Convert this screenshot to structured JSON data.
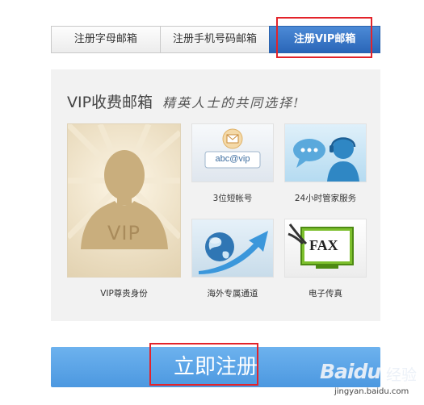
{
  "tabs": [
    {
      "label": "注册字母邮箱"
    },
    {
      "label": "注册手机号码邮箱"
    },
    {
      "label": "注册VIP邮箱",
      "active": true
    }
  ],
  "panel": {
    "heading": "VIP收费邮箱",
    "slogan": "精英人士的共同选择!",
    "vip_tile": {
      "text": "VIP",
      "caption": "VIP尊贵身份"
    },
    "features": [
      {
        "icon": "mail-address-icon",
        "text": "abc@vip",
        "caption": "3位短帐号"
      },
      {
        "icon": "chat-support-icon",
        "caption": "24小时管家服务"
      },
      {
        "icon": "globe-arrow-icon",
        "caption": "海外专属通道"
      },
      {
        "icon": "fax-monitor-icon",
        "text": "FAX",
        "caption": "电子传真"
      }
    ]
  },
  "register_button": {
    "label": "立即注册"
  },
  "watermark": {
    "logo": "Baidu",
    "suffix": "经验",
    "url": "jingyan.baidu.com"
  },
  "colors": {
    "accent": "#2a66b8",
    "button": "#5ba5e8",
    "highlight_box": "#e3232a"
  }
}
